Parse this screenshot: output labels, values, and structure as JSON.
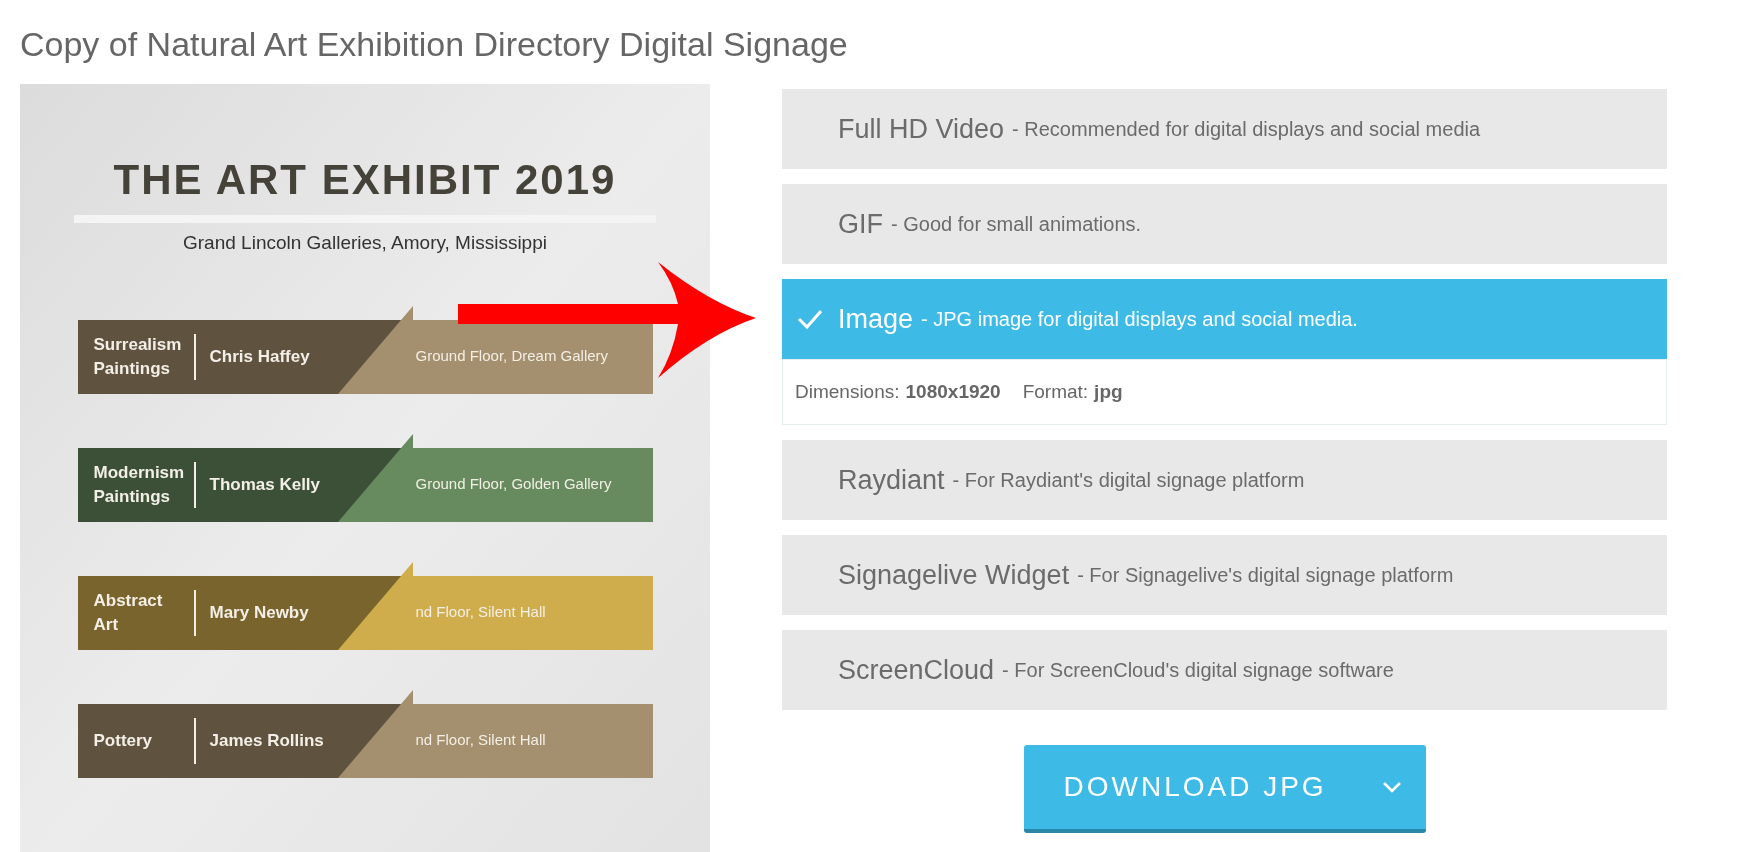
{
  "page_title": "Copy of Natural Art Exhibition Directory Digital Signage",
  "poster": {
    "title": "THE ART EXHIBIT 2019",
    "subtitle": "Grand Lincoln Galleries, Amory, Mississippi",
    "bands": [
      {
        "category": [
          "Surrealism",
          "Paintings"
        ],
        "artist": "Chris Haffey",
        "location": "Ground Floor, Dream Gallery",
        "color": "#a48f6e"
      },
      {
        "category": [
          "Modernism",
          "Paintings"
        ],
        "artist": "Thomas Kelly",
        "location": "Ground Floor, Golden Gallery",
        "color": "#678a5f"
      },
      {
        "category": [
          "Abstract",
          "Art"
        ],
        "artist": "Mary Newby",
        "location": "nd Floor, Silent Hall",
        "color": "#cfad4c"
      },
      {
        "category": [
          "Pottery"
        ],
        "artist": "James Rollins",
        "location": "nd Floor, Silent Hall",
        "color": "#a48f6e"
      }
    ]
  },
  "options": [
    {
      "name": "Full HD Video",
      "description": "- Recommended for digital displays and social media",
      "selected": false
    },
    {
      "name": "GIF",
      "description": "- Good for small animations.",
      "selected": false
    },
    {
      "name": "Image",
      "description": "- JPG image for digital displays and social media.",
      "selected": true,
      "details": [
        {
          "label": "Dimensions:",
          "value": "1080x1920"
        },
        {
          "label": "Format:",
          "value": "jpg"
        }
      ]
    },
    {
      "name": "Raydiant",
      "description": "- For Raydiant's digital signage platform",
      "selected": false
    },
    {
      "name": "Signagelive Widget",
      "description": "- For Signagelive's digital signage platform",
      "selected": false
    },
    {
      "name": "ScreenCloud",
      "description": "- For ScreenCloud's digital signage software",
      "selected": false
    }
  ],
  "download_button": {
    "label": "DOWNLOAD JPG"
  }
}
